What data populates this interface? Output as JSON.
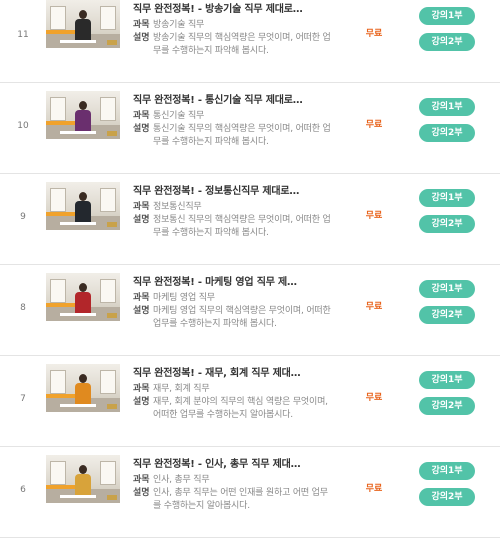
{
  "lectures": [
    {
      "number": "11",
      "title": "직무 완전정복! - 방송기술 직무 제대로…",
      "course_label": "과목",
      "course": "방송기술 직무",
      "desc_label": "설명",
      "description": "방송기술 직무의 핵심역량은 무엇이며, 어떠한 업무를 수행하는지 파악해 봅시다.",
      "price": "무료",
      "btn1": "강의1부",
      "btn2": "강의2부",
      "outfit_color": "#2a2a2a"
    },
    {
      "number": "10",
      "title": "직무 완전정복! - 통신기술 직무 제대로…",
      "course_label": "과목",
      "course": "통신기술 직무",
      "desc_label": "설명",
      "description": "통신기술 직무의 핵심역량은 무엇이며, 어떠한 업무를 수행하는지 파악해 봅시다.",
      "price": "무료",
      "btn1": "강의1부",
      "btn2": "강의2부",
      "outfit_color": "#6a2f6e"
    },
    {
      "number": "9",
      "title": "직무 완전정복! - 정보통신직무 제대로…",
      "course_label": "과목",
      "course": "정보통신직무",
      "desc_label": "설명",
      "description": "정보통신 직무의 핵심역량은 무엇이며, 어떠한 업무를 수행하는지 파악해 봅시다.",
      "price": "무료",
      "btn1": "강의1부",
      "btn2": "강의2부",
      "outfit_color": "#23282e"
    },
    {
      "number": "8",
      "title": "직무 완전정복! - 마케팅 영업 직무 제…",
      "course_label": "과목",
      "course": "마케팅 영업 직무",
      "desc_label": "설명",
      "description": "마케팅 영업 직무의 핵심역량은 무엇이며, 어떠한 업무를 수행하는지 파악해 봅시다.",
      "price": "무료",
      "btn1": "강의1부",
      "btn2": "강의2부",
      "outfit_color": "#b2262a"
    },
    {
      "number": "7",
      "title": "직무 완전정복! - 재무, 회계 직무 제대…",
      "course_label": "과목",
      "course": "재무, 회계 직무",
      "desc_label": "설명",
      "description": "재무, 회계 분야의 직무의 핵심 역량은 무엇이며, 어떠한 업무를 수행하는지 알아봅시다.",
      "price": "무료",
      "btn1": "강의1부",
      "btn2": "강의2부",
      "outfit_color": "#e08a1f"
    },
    {
      "number": "6",
      "title": "직무 완전정복! - 인사, 총무 직무 제대…",
      "course_label": "과목",
      "course": "인사, 총무 직무",
      "desc_label": "설명",
      "description": "인사, 총무 직무는 어떤 인재를 원하고 어떤 업무를 수행하는지 알아봅시다.",
      "price": "무료",
      "btn1": "강의1부",
      "btn2": "강의2부",
      "outfit_color": "#d8a33a"
    }
  ]
}
